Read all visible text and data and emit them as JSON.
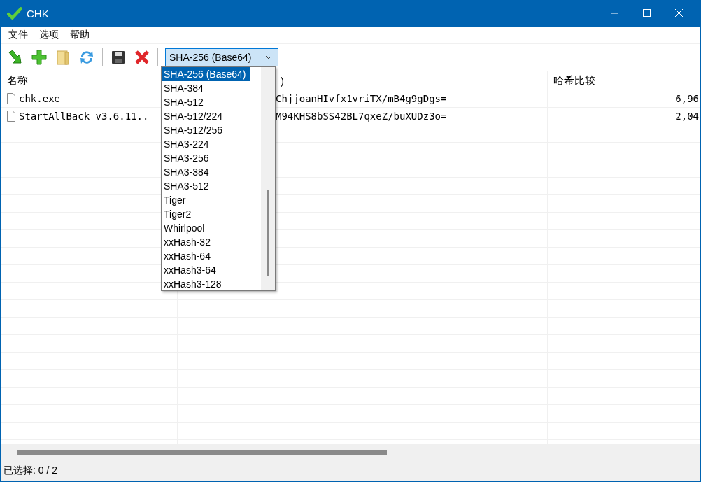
{
  "window": {
    "title": "CHK"
  },
  "menu": [
    "文件",
    "选项",
    "帮助"
  ],
  "toolbar": [
    {
      "kind": "import"
    },
    {
      "kind": "add"
    },
    {
      "kind": "folder"
    },
    {
      "kind": "refresh"
    },
    {
      "kind": "sep"
    },
    {
      "kind": "save"
    },
    {
      "kind": "delete"
    },
    {
      "kind": "sep"
    }
  ],
  "algorithm_select": {
    "value": "SHA-256 (Base64)",
    "expanded": true
  },
  "dropdown_options": [
    {
      "label": "SHA-256 (Base64)",
      "selected": true
    },
    {
      "label": "SHA-384",
      "selected": false
    },
    {
      "label": "SHA-512",
      "selected": false
    },
    {
      "label": "SHA-512/224",
      "selected": false
    },
    {
      "label": "SHA-512/256",
      "selected": false
    },
    {
      "label": "SHA3-224",
      "selected": false
    },
    {
      "label": "SHA3-256",
      "selected": false
    },
    {
      "label": "SHA3-384",
      "selected": false
    },
    {
      "label": "SHA3-512",
      "selected": false
    },
    {
      "label": "Tiger",
      "selected": false
    },
    {
      "label": "Tiger2",
      "selected": false
    },
    {
      "label": "Whirlpool",
      "selected": false
    },
    {
      "label": "xxHash-32",
      "selected": false
    },
    {
      "label": "xxHash-64",
      "selected": false
    },
    {
      "label": "xxHash3-64",
      "selected": false
    },
    {
      "label": "xxHash3-128",
      "selected": false
    }
  ],
  "table": {
    "columns": [
      "名称",
      ")",
      "哈希比较"
    ],
    "rows": [
      {
        "name": "chk.exe",
        "hash": "ChjjoanHIvfx1vriTX/mB4g9gDgs=",
        "compare": "",
        "size": "6,96"
      },
      {
        "name": "StartAllBack v3.6.11..",
        "hash": "M94KHS8bSS42BL7qxeZ/buXUDz3o=",
        "compare": "",
        "size": "2,04"
      }
    ]
  },
  "status_bar": "已选择: 0 / 2"
}
